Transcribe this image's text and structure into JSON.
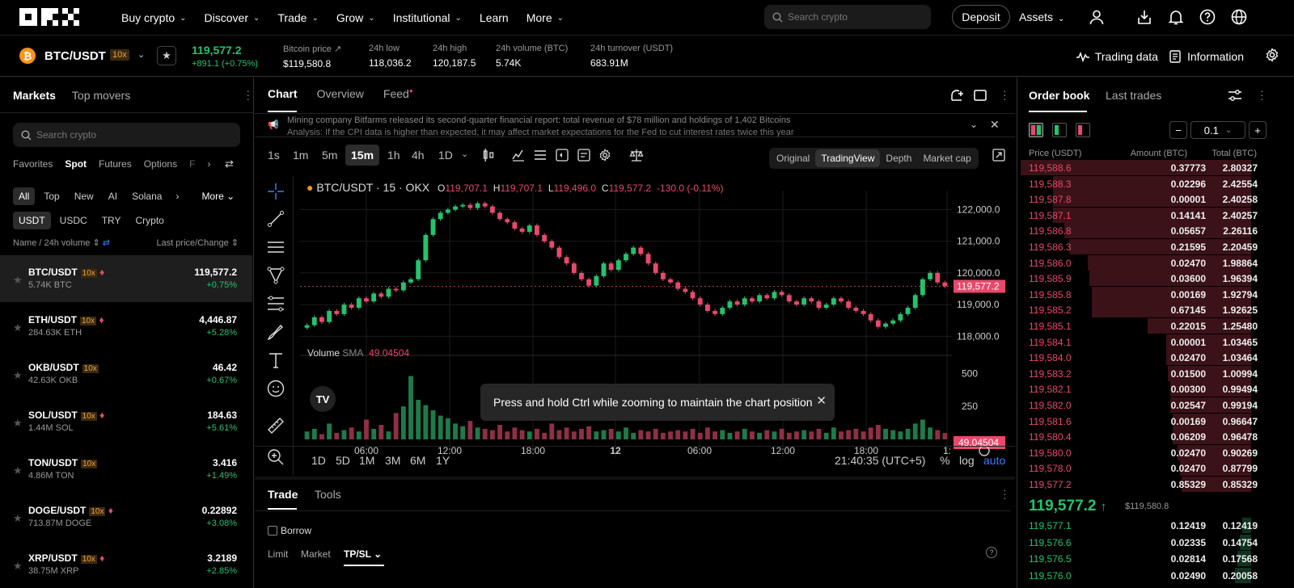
{
  "nav": {
    "menu": [
      "Buy crypto",
      "Discover",
      "Trade",
      "Grow",
      "Institutional",
      "Learn",
      "More"
    ],
    "search_placeholder": "Search crypto",
    "deposit": "Deposit",
    "assets": "Assets"
  },
  "ticker": {
    "coin_symbol": "₿",
    "pair": "BTC/USDT",
    "leverage": "10x",
    "last": "119,577.2",
    "change": "+891.1 (+0.75%)",
    "stats": [
      {
        "k": "Bitcoin price",
        "v": "$119,580.8"
      },
      {
        "k": "24h low",
        "v": "118,036.2"
      },
      {
        "k": "24h high",
        "v": "120,187.5"
      },
      {
        "k": "24h volume (BTC)",
        "v": "5.74K"
      },
      {
        "k": "24h turnover (USDT)",
        "v": "683.91M"
      }
    ],
    "trading_data": "Trading data",
    "information": "Information"
  },
  "left": {
    "tabs": [
      "Markets",
      "Top movers"
    ],
    "search_placeholder": "Search crypto",
    "types": [
      "Favorites",
      "Spot",
      "Futures",
      "Options",
      "F"
    ],
    "filters": [
      "All",
      "Top",
      "New",
      "AI",
      "Solana",
      "More"
    ],
    "quotes": [
      "USDT",
      "USDC",
      "TRY",
      "Crypto"
    ],
    "col_left": "Name / 24h volume",
    "col_right": "Last price/Change",
    "rows": [
      {
        "pair": "BTC/USDT",
        "lev": "10x",
        "vol": "5.74K BTC",
        "price": "119,577.2",
        "change": "+0.75%"
      },
      {
        "pair": "ETH/USDT",
        "lev": "10x",
        "vol": "284.63K ETH",
        "price": "4,446.87",
        "change": "+5.28%"
      },
      {
        "pair": "OKB/USDT",
        "lev": "10x",
        "vol": "42.63K OKB",
        "price": "46.42",
        "change": "+0.67%"
      },
      {
        "pair": "SOL/USDT",
        "lev": "10x",
        "vol": "1.44M SOL",
        "price": "184.63",
        "change": "+5.61%"
      },
      {
        "pair": "TON/USDT",
        "lev": "10x",
        "vol": "4.86M TON",
        "price": "3.416",
        "change": "+1.49%"
      },
      {
        "pair": "DOGE/USDT",
        "lev": "10x",
        "vol": "713.87M DOGE",
        "price": "0.22892",
        "change": "+3.08%"
      },
      {
        "pair": "XRP/USDT",
        "lev": "10x",
        "vol": "38.75M XRP",
        "price": "3.2189",
        "change": "+2.85%"
      }
    ]
  },
  "center": {
    "tabs": [
      "Chart",
      "Overview",
      "Feed"
    ],
    "news": [
      "Mining company Bitfarms released its second-quarter financial report: total revenue of $78 million and holdings of 1,402 Bitcoins",
      "Analysis: If the CPI data is higher than expected, it may affect market expectations for the Fed to cut interest rates twice this year"
    ],
    "timeframes": [
      "1s",
      "1m",
      "5m",
      "15m",
      "1h",
      "4h",
      "1D"
    ],
    "modes": [
      "Original",
      "TradingView",
      "Depth",
      "Market cap"
    ],
    "legend": {
      "title": "BTC/USDT · 15 · OKX",
      "o": "119,707.1",
      "h": "119,707.1",
      "l": "119,496.0",
      "c": "119,577.2",
      "chg": "-130.0 (-0.11%)"
    },
    "volume_label": "Volume",
    "sma_label": "SMA",
    "sma_value": "49.04504",
    "price_tag": "119,577.2",
    "vol_tag": "49.04504",
    "ranges": [
      "1D",
      "5D",
      "1M",
      "3M",
      "6M",
      "1Y"
    ],
    "clock": "21:40:35 (UTC+5)",
    "pct": "%",
    "log": "log",
    "auto": "auto",
    "toast": "Press and hold Ctrl while zooming to maintain the chart position",
    "bottom_tabs": [
      "Trade",
      "Tools"
    ],
    "borrow": "Borrow",
    "order_types": [
      "Limit",
      "Market",
      "TP/SL"
    ]
  },
  "chart_data": {
    "type": "candlestick",
    "interval": "15",
    "y_ticks": [
      "122,000.0",
      "121,000.0",
      "120,000.0",
      "119,000.0",
      "118,000.0"
    ],
    "x_ticks": [
      "06:00",
      "12:00",
      "18:00",
      "12",
      "06:00",
      "12:00",
      "18:00",
      "1:"
    ],
    "vol_ticks": [
      "500",
      "250"
    ],
    "last_price": 119577.2,
    "ylim": [
      117600,
      122600
    ],
    "vol_max": 600,
    "closes": [
      118350,
      118600,
      118450,
      118800,
      118700,
      119000,
      118900,
      119200,
      119100,
      119350,
      119250,
      119500,
      119450,
      119700,
      119800,
      120400,
      121200,
      121700,
      121900,
      122000,
      122100,
      122150,
      122050,
      122200,
      122100,
      121900,
      121700,
      121600,
      121400,
      121300,
      121500,
      121200,
      121000,
      120800,
      120500,
      120300,
      120000,
      119800,
      119600,
      119900,
      120300,
      120100,
      120400,
      120600,
      120800,
      120600,
      120300,
      120000,
      119800,
      119700,
      119500,
      119400,
      119200,
      119000,
      118800,
      118700,
      118900,
      119100,
      119000,
      119200,
      119100,
      119300,
      119200,
      119400,
      119300,
      119100,
      119000,
      119200,
      119100,
      118900,
      119000,
      119200,
      119100,
      118900,
      118800,
      118700,
      118500,
      118300,
      118400,
      118500,
      118700,
      118900,
      119300,
      119800,
      120000,
      119700,
      119577
    ],
    "volumes": [
      60,
      80,
      40,
      120,
      50,
      70,
      90,
      60,
      150,
      80,
      110,
      60,
      200,
      250,
      480,
      300,
      260,
      220,
      180,
      160,
      120,
      100,
      140,
      90,
      80,
      70,
      110,
      60,
      90,
      70,
      60,
      80,
      50,
      120,
      70,
      90,
      60,
      80,
      100,
      60,
      70,
      80,
      60,
      90,
      50,
      70,
      60,
      80,
      50,
      60,
      70,
      60,
      80,
      50,
      90,
      60,
      70,
      50,
      60,
      80,
      60,
      50,
      70,
      60,
      80,
      50,
      60,
      70,
      60,
      80,
      50,
      90,
      60,
      70,
      80,
      60,
      90,
      110,
      80,
      70,
      60,
      80,
      120,
      150,
      90,
      70,
      49
    ]
  },
  "orderbook": {
    "tabs": [
      "Order book",
      "Last trades"
    ],
    "step": "0.1",
    "headers": [
      "Price (USDT)",
      "Amount (BTC)",
      "Total (BTC)"
    ],
    "asks": [
      [
        "119,588.6",
        "0.37773",
        "2.80327"
      ],
      [
        "119,588.3",
        "0.02296",
        "2.42554"
      ],
      [
        "119,587.8",
        "0.00001",
        "2.40258"
      ],
      [
        "119,587.1",
        "0.14141",
        "2.40257"
      ],
      [
        "119,586.8",
        "0.05657",
        "2.26116"
      ],
      [
        "119,586.3",
        "0.21595",
        "2.20459"
      ],
      [
        "119,586.0",
        "0.02470",
        "1.98864"
      ],
      [
        "119,585.9",
        "0.03600",
        "1.96394"
      ],
      [
        "119,585.8",
        "0.00169",
        "1.92794"
      ],
      [
        "119,585.2",
        "0.67145",
        "1.92625"
      ],
      [
        "119,585.1",
        "0.22015",
        "1.25480"
      ],
      [
        "119,584.1",
        "0.00001",
        "1.03465"
      ],
      [
        "119,584.0",
        "0.02470",
        "1.03464"
      ],
      [
        "119,583.2",
        "0.01500",
        "1.00994"
      ],
      [
        "119,582.1",
        "0.00300",
        "0.99494"
      ],
      [
        "119,582.0",
        "0.02547",
        "0.99194"
      ],
      [
        "119,581.6",
        "0.00169",
        "0.96647"
      ],
      [
        "119,580.4",
        "0.06209",
        "0.96478"
      ],
      [
        "119,580.0",
        "0.02470",
        "0.90269"
      ],
      [
        "119,578.0",
        "0.02470",
        "0.87799"
      ],
      [
        "119,577.2",
        "0.85329",
        "0.85329"
      ]
    ],
    "ask_depth": [
      1.0,
      0.86,
      0.86,
      0.86,
      0.81,
      0.79,
      0.71,
      0.7,
      0.69,
      0.69,
      0.45,
      0.37,
      0.37,
      0.36,
      0.35,
      0.35,
      0.34,
      0.34,
      0.32,
      0.31,
      0.3
    ],
    "mid": "119,577.2",
    "mid_arrow": "↑",
    "mid_usd": "$119,580.8",
    "bids": [
      [
        "119,577.1",
        "0.12419",
        "0.12419"
      ],
      [
        "119,576.6",
        "0.02335",
        "0.14754"
      ],
      [
        "119,576.5",
        "0.02814",
        "0.17568"
      ],
      [
        "119,576.0",
        "0.02490",
        "0.20058"
      ]
    ],
    "bid_depth": [
      0.04,
      0.05,
      0.06,
      0.07
    ]
  },
  "colors": {
    "up": "#25c26e",
    "down": "#e8496b",
    "bg": "#000000"
  }
}
